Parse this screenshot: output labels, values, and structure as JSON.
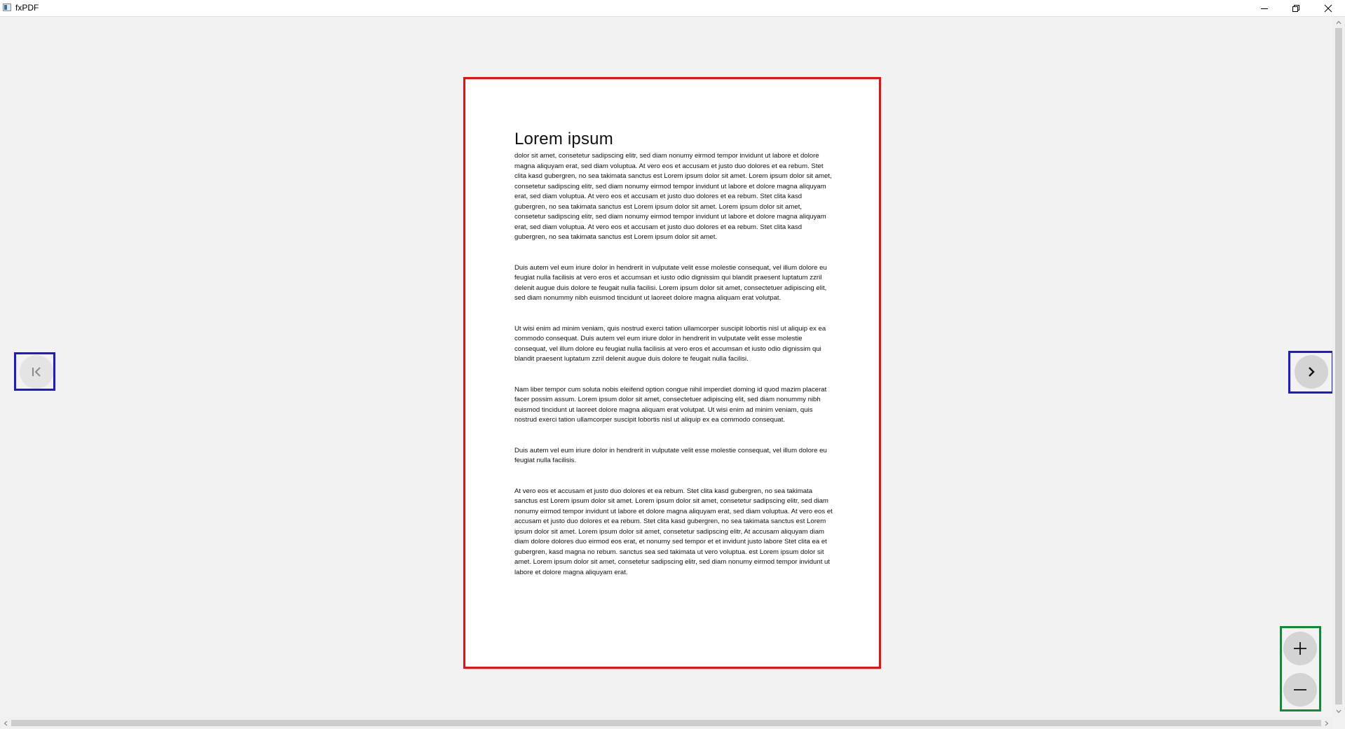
{
  "window": {
    "title": "fxPDF",
    "minimize_icon": "minimize-icon",
    "maximize_icon": "restore-icon",
    "close_icon": "close-icon"
  },
  "document": {
    "title": "Lorem ipsum",
    "paragraphs": [
      "dolor sit amet, consetetur sadipscing elitr, sed diam nonumy eirmod tempor invidunt ut labore et dolore magna aliquyam erat, sed diam voluptua. At vero eos et accusam et justo duo dolores et ea rebum. Stet clita kasd gubergren, no sea takimata sanctus est Lorem ipsum dolor sit amet. Lorem ipsum dolor sit amet, consetetur sadipscing elitr, sed diam nonumy eirmod tempor invidunt ut labore et dolore magna aliquyam erat, sed diam voluptua. At vero eos et accusam et justo duo dolores et ea rebum. Stet clita kasd gubergren, no sea takimata sanctus est Lorem ipsum dolor sit amet. Lorem ipsum dolor sit amet, consetetur sadipscing elitr, sed diam nonumy eirmod tempor invidunt ut labore et dolore magna aliquyam erat, sed diam voluptua. At vero eos et accusam et justo duo dolores et ea rebum. Stet clita kasd gubergren, no sea takimata sanctus est Lorem ipsum dolor sit amet.",
      "Duis autem vel eum iriure dolor in hendrerit in vulputate velit esse molestie consequat, vel illum dolore eu feugiat nulla facilisis at vero eros et accumsan et iusto odio dignissim qui blandit praesent luptatum zzril delenit augue duis dolore te feugait nulla facilisi. Lorem ipsum dolor sit amet, consectetuer adipiscing elit, sed diam nonummy nibh euismod tincidunt ut laoreet dolore magna aliquam erat volutpat.",
      "Ut wisi enim ad minim veniam, quis nostrud exerci tation ullamcorper suscipit lobortis nisl ut aliquip ex ea commodo consequat. Duis autem vel eum iriure dolor in hendrerit in vulputate velit esse molestie consequat, vel illum dolore eu feugiat nulla facilisis at vero eros et accumsan et iusto odio dignissim qui blandit praesent luptatum zzril delenit augue duis dolore te feugait nulla facilisi.",
      "Nam liber tempor cum soluta nobis eleifend option congue nihil imperdiet doming id quod mazim placerat facer possim assum. Lorem ipsum dolor sit amet, consectetuer adipiscing elit, sed diam nonummy nibh euismod tincidunt ut laoreet dolore magna aliquam erat volutpat. Ut wisi enim ad minim veniam, quis nostrud exerci tation ullamcorper suscipit lobortis nisl ut aliquip ex ea commodo consequat.",
      "Duis autem vel eum iriure dolor in hendrerit in vulputate velit esse molestie consequat, vel illum dolore eu feugiat nulla facilisis.",
      "At vero eos et accusam et justo duo dolores et ea rebum. Stet clita kasd gubergren, no sea takimata sanctus est Lorem ipsum dolor sit amet. Lorem ipsum dolor sit amet, consetetur sadipscing elitr, sed diam nonumy eirmod tempor invidunt ut labore et dolore magna aliquyam erat, sed diam voluptua. At vero eos et accusam et justo duo dolores et ea rebum. Stet clita kasd gubergren, no sea takimata sanctus est Lorem ipsum dolor sit amet. Lorem ipsum dolor sit amet, consetetur sadipscing elitr, At accusam aliquyam diam diam dolore dolores duo eirmod eos erat, et nonumy sed tempor et et invidunt justo labore Stet clita ea et gubergren, kasd magna no rebum. sanctus sea sed takimata ut vero voluptua. est Lorem ipsum dolor sit amet. Lorem ipsum dolor sit amet, consetetur sadipscing elitr, sed diam nonumy eirmod tempor invidunt ut labore et dolore magna aliquyam erat."
    ]
  },
  "navigation": {
    "prev_icon": "first-page-icon",
    "next_icon": "chevron-right-icon"
  },
  "zoom": {
    "in_icon": "plus-icon",
    "out_icon": "minus-icon"
  },
  "colors": {
    "page_highlight": "#e81010",
    "nav_highlight": "#1a1ad8",
    "zoom_highlight": "#128a3a",
    "button_fill": "#d4d4d4",
    "background": "#f2f2f2"
  }
}
